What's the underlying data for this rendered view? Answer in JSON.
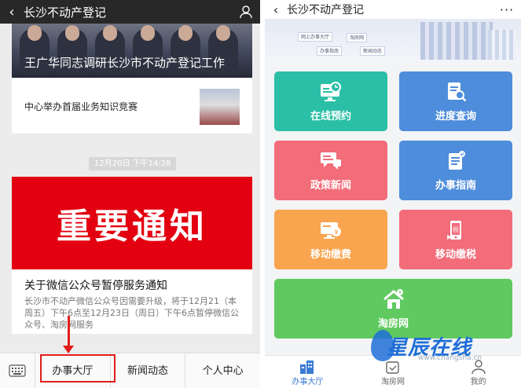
{
  "left": {
    "topbar": {
      "title": "长沙不动产登记"
    },
    "news1": {
      "headline": "王广华同志调研长沙市不动产登记工作",
      "subtitle": "中心举办首届业务知识竞赛"
    },
    "timestamp": "12月20日 下午14:28",
    "news2": {
      "banner": "重要通知",
      "title": "关于微信公众号暂停服务通知",
      "body": "长沙市不动产微信公众号因需要升级，将于12月21（本周五）下午6点至12月23日（周日）下午6点暂停微信公众号、淘房网服务"
    },
    "bottom_tabs": [
      "办事大厅",
      "新闻动态",
      "个人中心"
    ]
  },
  "right": {
    "topbar": {
      "title": "长沙不动产登记",
      "more": "···"
    },
    "banner_chips": [
      "网上办事大厅",
      "办事指南",
      "淘房网",
      "新闻动态"
    ],
    "tiles": [
      {
        "label": "在线预约",
        "color": "#2bbfa7",
        "icon": "monitor-clock-icon"
      },
      {
        "label": "进度查询",
        "color": "#4e8ddb",
        "icon": "document-search-icon"
      },
      {
        "label": "政策新闻",
        "color": "#f26c79",
        "icon": "chat-bubbles-icon"
      },
      {
        "label": "办事指南",
        "color": "#4e8ddb",
        "icon": "guide-document-icon"
      },
      {
        "label": "移动缴费",
        "color": "#f9a44e",
        "icon": "monitor-yen-icon"
      },
      {
        "label": "移动缴税",
        "color": "#f26c79",
        "icon": "phone-tax-icon"
      },
      {
        "label": "淘房网",
        "color": "#60c960",
        "icon": "house-yen-icon"
      }
    ],
    "nav": [
      {
        "label": "办事大厅",
        "icon": "buildings-icon"
      },
      {
        "label": "淘房网",
        "icon": "house-check-icon"
      },
      {
        "label": "我的",
        "icon": "person-icon"
      }
    ]
  },
  "watermark": {
    "text": "星辰在线",
    "sub": "www.changsha.cn"
  }
}
